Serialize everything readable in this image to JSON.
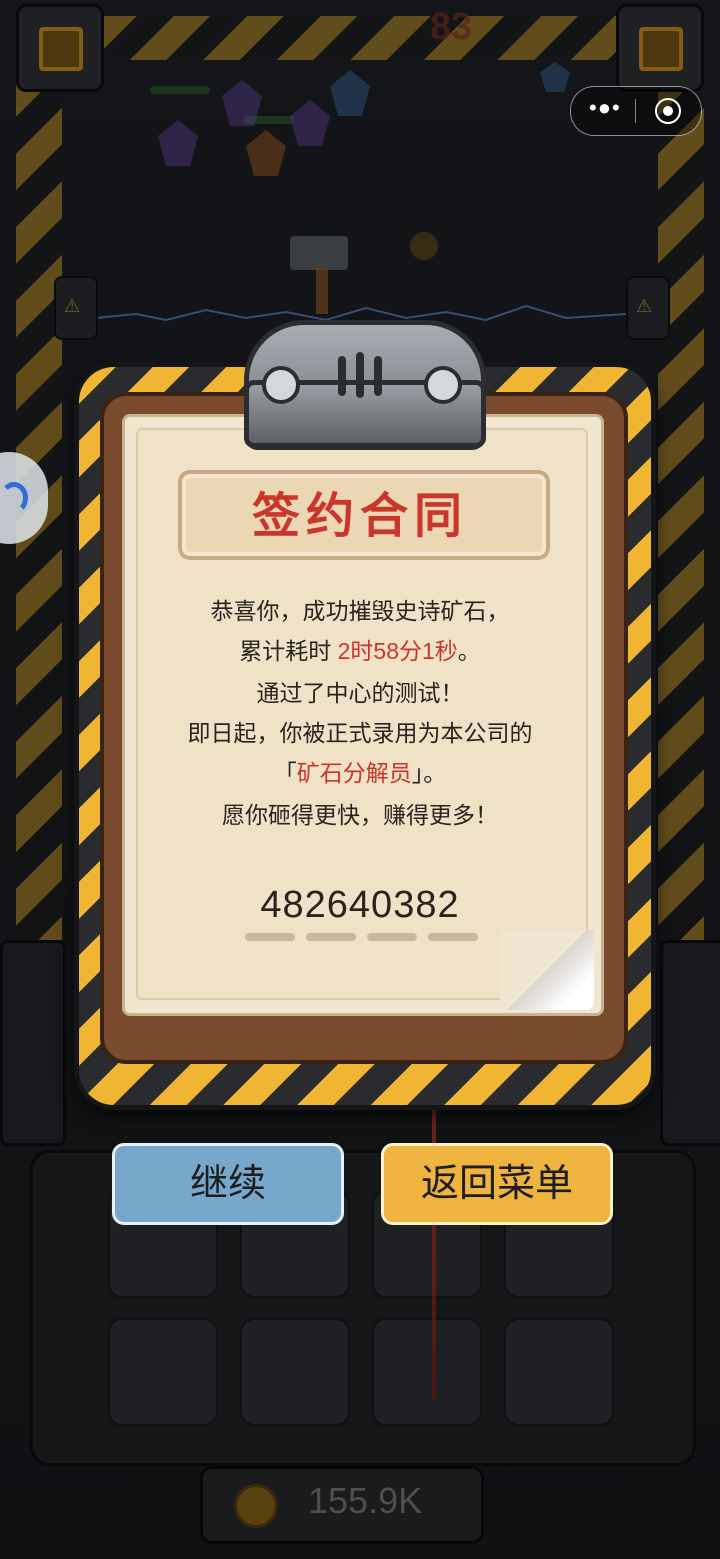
{
  "wechat_capsule": {
    "menu_icon": "more-dots-icon",
    "close_icon": "target-circle-icon"
  },
  "background": {
    "score": "83",
    "coin_balance": "155.9K"
  },
  "contract_dialog": {
    "title": "签约合同",
    "line1": "恭喜你，成功摧毁史诗矿石，",
    "line2_prefix": "累计耗时 ",
    "line2_time": "2时58分1秒",
    "line2_suffix": "。",
    "line3": "通过了中心的测试！",
    "line4": "即日起，你被正式录用为本公司的",
    "line5_open": "「",
    "line5_role": "矿石分解员",
    "line5_close": "」。",
    "line6": "愿你砸得更快，赚得更多！",
    "employee_number": "482640382"
  },
  "buttons": {
    "continue_label": "继续",
    "menu_label": "返回菜单"
  },
  "colors": {
    "highlight_red": "#c9362b",
    "continue_blue": "#78a7cc",
    "menu_yellow": "#efb33f",
    "hazard_yellow": "#f0b532"
  }
}
